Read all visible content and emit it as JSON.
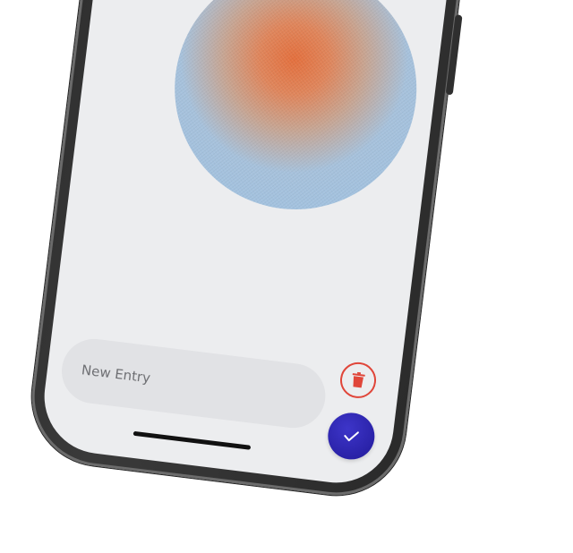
{
  "entry": {
    "placeholder": "New Entry"
  },
  "icons": {
    "delete": "trash-icon",
    "confirm": "checkmark-icon"
  },
  "colors": {
    "screen_background": "#ecedef",
    "delete_accent": "#e0463a",
    "confirm_button": "#2a22a8",
    "phone_frame": "#2c2c2c"
  }
}
